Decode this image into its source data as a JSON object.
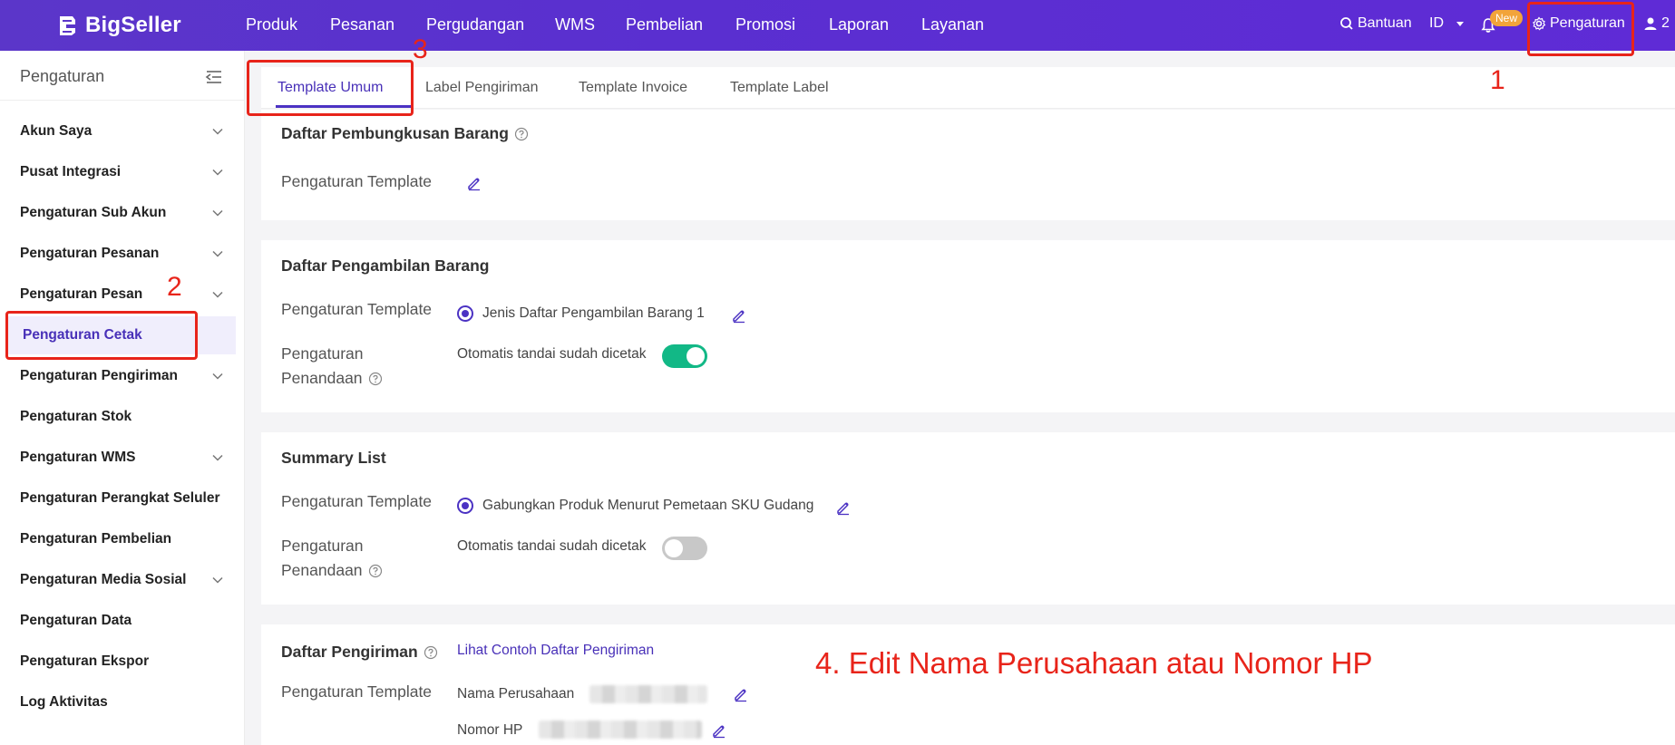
{
  "brand": {
    "name": "BigSeller"
  },
  "topnav": {
    "items": [
      "Produk",
      "Pesanan",
      "Pergudangan",
      "WMS",
      "Pembelian",
      "Promosi",
      "Laporan",
      "Layanan"
    ],
    "help": "Bantuan",
    "language": "ID",
    "new_badge": "New",
    "settings": "Pengaturan",
    "user_count": "2"
  },
  "sidebar": {
    "title": "Pengaturan",
    "items": [
      {
        "label": "Akun Saya"
      },
      {
        "label": "Pusat Integrasi"
      },
      {
        "label": "Pengaturan Sub Akun"
      },
      {
        "label": "Pengaturan Pesanan"
      },
      {
        "label": "Pengaturan Pesan"
      },
      {
        "label": "Pengaturan Cetak"
      },
      {
        "label": "Pengaturan Pengiriman"
      },
      {
        "label": "Pengaturan Stok"
      },
      {
        "label": "Pengaturan WMS"
      },
      {
        "label": "Pengaturan Perangkat Seluler"
      },
      {
        "label": "Pengaturan Pembelian"
      },
      {
        "label": "Pengaturan Media Sosial"
      },
      {
        "label": "Pengaturan Data"
      },
      {
        "label": "Pengaturan Ekspor"
      },
      {
        "label": "Log Aktivitas"
      }
    ]
  },
  "tabs": [
    "Template Umum",
    "Label Pengiriman",
    "Template Invoice",
    "Template Label"
  ],
  "sections": {
    "packing": {
      "title": "Daftar Pembungkusan Barang",
      "template_label": "Pengaturan Template"
    },
    "picking": {
      "title": "Daftar Pengambilan Barang",
      "template_label": "Pengaturan Template",
      "template_value": "Jenis Daftar Pengambilan Barang 1",
      "mark_label_1": "Pengaturan",
      "mark_label_2": "Penandaan",
      "mark_value": "Otomatis tandai sudah dicetak"
    },
    "summary": {
      "title": "Summary List",
      "template_label": "Pengaturan Template",
      "template_value": "Gabungkan Produk Menurut Pemetaan SKU Gudang",
      "mark_label_1": "Pengaturan",
      "mark_label_2": "Penandaan",
      "mark_value": "Otomatis tandai sudah dicetak"
    },
    "shipping": {
      "title": "Daftar Pengiriman",
      "link": "Lihat Contoh Daftar Pengiriman",
      "template_label": "Pengaturan Template",
      "company_label": "Nama Perusahaan",
      "phone_label": "Nomor HP"
    }
  },
  "annotations": {
    "n1": "1",
    "n2": "2",
    "n3": "3",
    "note4": "4. Edit Nama Perusahaan atau Nomor HP",
    "color": "#e8241a"
  }
}
